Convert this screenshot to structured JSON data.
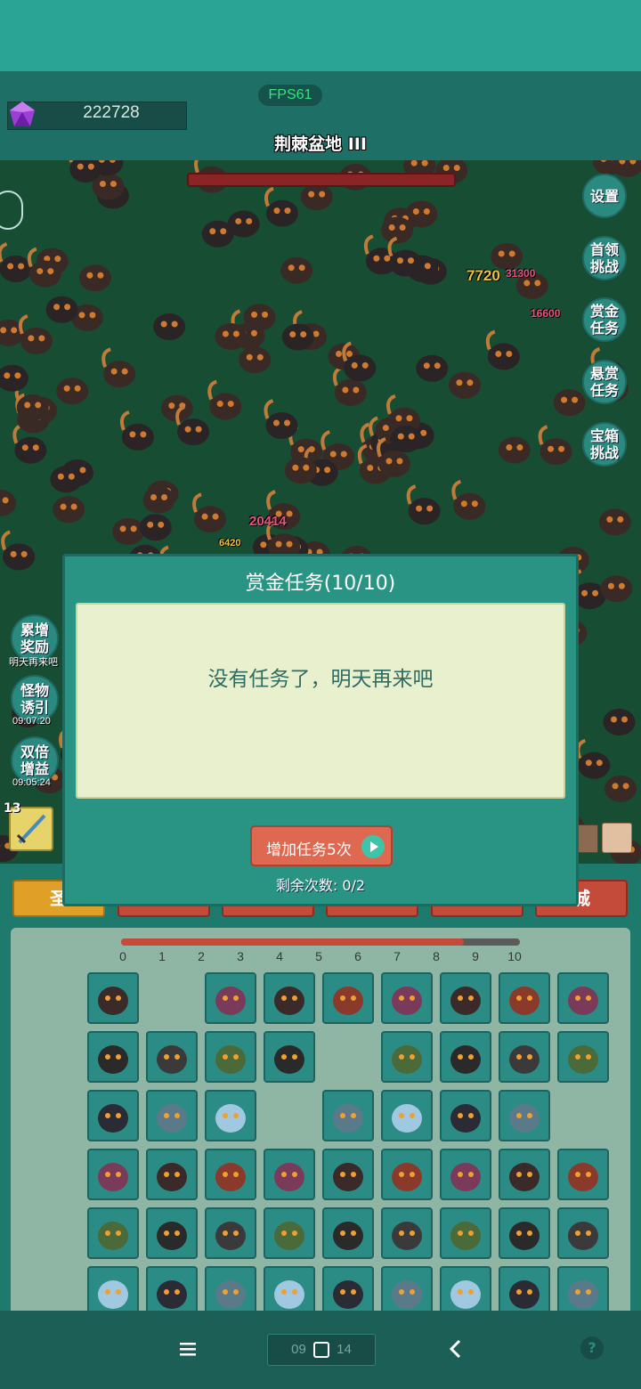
{
  "hud": {
    "gems": "222728",
    "fps": "FPS61",
    "stage": "荆棘盆地 III"
  },
  "side_right": [
    {
      "label": "设置"
    },
    {
      "label": "首领\n挑战"
    },
    {
      "label": "赏金\n任务"
    },
    {
      "label": "悬赏\n任务"
    },
    {
      "label": "宝箱\n挑战"
    }
  ],
  "side_left": [
    {
      "label": "累增\n奖励",
      "sub": "明天再来吧"
    },
    {
      "label": "怪物\n诱引",
      "sub": "09:07:20"
    },
    {
      "label": "双倍\n增益",
      "sub": "09:05:24"
    }
  ],
  "damage_numbers": [
    "7720",
    "31300",
    "16600",
    "20414",
    "6420"
  ],
  "slot": {
    "level": "13"
  },
  "tabs": [
    "圣",
    "",
    "",
    "",
    "",
    "城"
  ],
  "level_bar": {
    "levels": [
      "0",
      "1",
      "2",
      "3",
      "4",
      "5",
      "6",
      "7",
      "8",
      "9",
      "10"
    ],
    "progress": 0.86
  },
  "modal": {
    "title": "赏金任务(10/10)",
    "message": "没有任务了，明天再来吧",
    "add_button": "增加任务5次",
    "remaining": "剩余次数: 0/2"
  },
  "navbar": {
    "center_text": "09",
    "center_tail": "14"
  },
  "colors": {
    "accent": "#2aa595",
    "button_red": "#de6850",
    "field": "#174d33"
  }
}
